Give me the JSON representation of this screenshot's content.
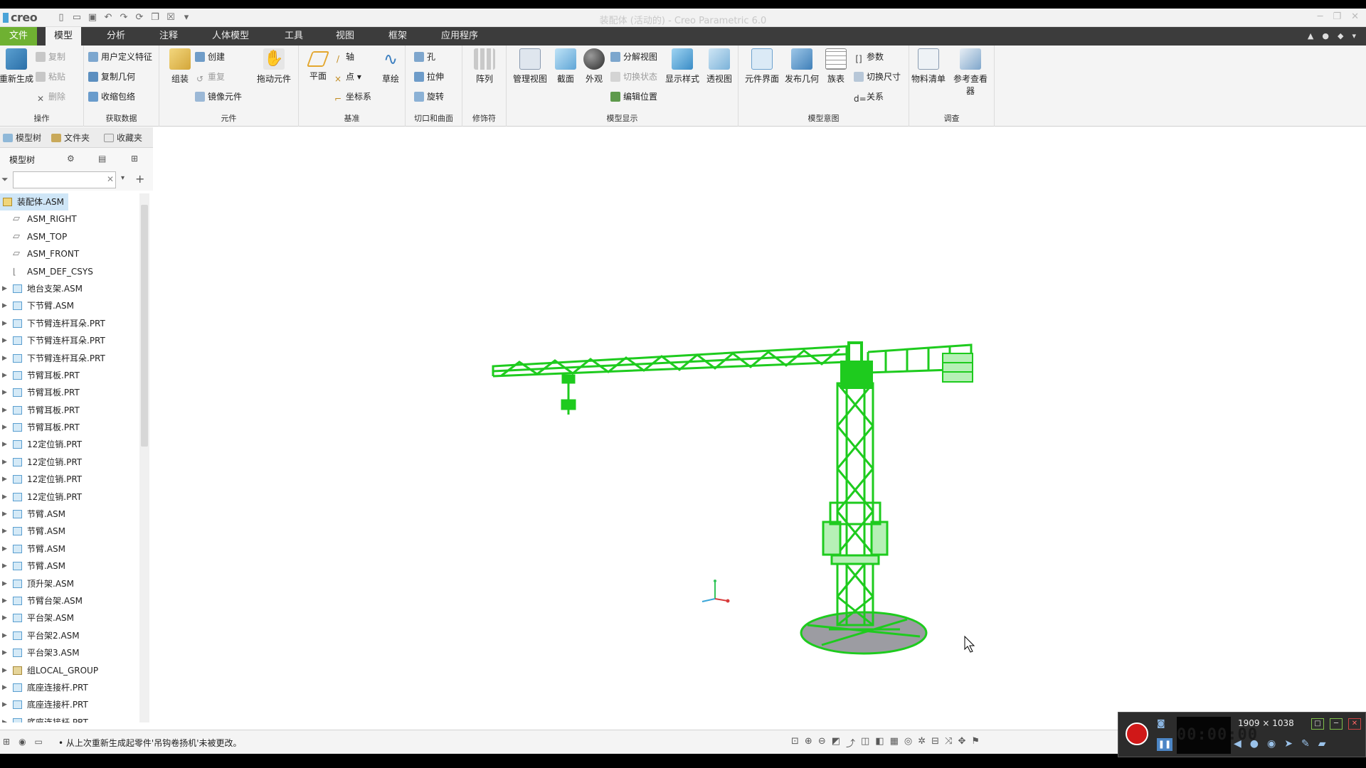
{
  "app": {
    "logo": "creo",
    "window_title": "装配体 (活动的) - Creo Parametric 6.0"
  },
  "menu": {
    "file": "文件",
    "tabs": [
      "模型",
      "分析",
      "注释",
      "人体模型",
      "工具",
      "视图",
      "框架",
      "应用程序"
    ],
    "active_tab": "模型"
  },
  "ribbon": {
    "groups": {
      "operations": {
        "label": "操作",
        "regen": "重新生成",
        "copy": "复制",
        "paste": "粘贴",
        "delete": "删除"
      },
      "get_data": {
        "label": "获取数据",
        "udf": "用户定义特征",
        "copy_geom": "复制几何",
        "shrinkwrap": "收缩包络"
      },
      "component": {
        "label": "元件",
        "assemble": "组装",
        "create": "创建",
        "repeat": "重复",
        "mirror": "镜像元件",
        "drag": "拖动元件"
      },
      "datum": {
        "label": "基准",
        "plane": "平面",
        "axis": "轴",
        "point": "点",
        "csys": "坐标系",
        "sketch": "草绘"
      },
      "cut_surface": {
        "label": "切口和曲面",
        "hole": "孔",
        "extrude": "拉伸",
        "revolve": "旋转"
      },
      "modifiers": {
        "label": "修饰符",
        "pattern": "阵列"
      },
      "model_display": {
        "label": "模型显示",
        "manage_views": "管理视图",
        "section": "截面",
        "appearance": "外观",
        "explode": "分解视图",
        "toggle_state": "切换状态",
        "edit_position": "编辑位置",
        "display_style": "显示样式",
        "perspective": "透视图"
      },
      "model_intent": {
        "label": "模型意图",
        "component_interface": "元件界面",
        "publish_geom": "发布几何",
        "family_table": "族表",
        "params": "参数",
        "switch_dims": "切换尺寸",
        "relations": "关系"
      },
      "investigate": {
        "label": "调查",
        "bom": "物料清单",
        "ref_viewer": "参考查看器"
      }
    }
  },
  "left_panel": {
    "tabs": [
      "模型树",
      "文件夹",
      "收藏夹"
    ],
    "tree_title": "模型树",
    "filter_value": "",
    "items": [
      {
        "label": "装配体.ASM",
        "type": "root"
      },
      {
        "label": "ASM_RIGHT",
        "type": "plane"
      },
      {
        "label": "ASM_TOP",
        "type": "plane"
      },
      {
        "label": "ASM_FRONT",
        "type": "plane"
      },
      {
        "label": "ASM_DEF_CSYS",
        "type": "csys"
      },
      {
        "label": "地台支架.ASM",
        "type": "asm"
      },
      {
        "label": "下节臂.ASM",
        "type": "asm"
      },
      {
        "label": "下节臂连杆耳朵.PRT",
        "type": "prt"
      },
      {
        "label": "下节臂连杆耳朵.PRT",
        "type": "prt"
      },
      {
        "label": "下节臂连杆耳朵.PRT",
        "type": "prt"
      },
      {
        "label": "节臂耳板.PRT",
        "type": "prt"
      },
      {
        "label": "节臂耳板.PRT",
        "type": "prt"
      },
      {
        "label": "节臂耳板.PRT",
        "type": "prt"
      },
      {
        "label": "节臂耳板.PRT",
        "type": "prt"
      },
      {
        "label": "12定位销.PRT",
        "type": "prt"
      },
      {
        "label": "12定位销.PRT",
        "type": "prt"
      },
      {
        "label": "12定位销.PRT",
        "type": "prt"
      },
      {
        "label": "12定位销.PRT",
        "type": "prt"
      },
      {
        "label": "节臂.ASM",
        "type": "asm"
      },
      {
        "label": "节臂.ASM",
        "type": "asm"
      },
      {
        "label": "节臂.ASM",
        "type": "asm"
      },
      {
        "label": "节臂.ASM",
        "type": "asm"
      },
      {
        "label": "顶升架.ASM",
        "type": "asm"
      },
      {
        "label": "节臂台架.ASM",
        "type": "asm"
      },
      {
        "label": "平台架.ASM",
        "type": "asm"
      },
      {
        "label": "平台架2.ASM",
        "type": "asm"
      },
      {
        "label": "平台架3.ASM",
        "type": "asm"
      },
      {
        "label": "组LOCAL_GROUP",
        "type": "group"
      },
      {
        "label": "底座连接杆.PRT",
        "type": "prt"
      },
      {
        "label": "底座连接杆.PRT",
        "type": "prt"
      },
      {
        "label": "底座连接杆.PRT",
        "type": "prt"
      }
    ]
  },
  "status": {
    "message": "• 从上次重新生成起零件'吊钩卷扬机'未被更改。"
  },
  "recorder": {
    "time": "00:00:00",
    "resolution": "1909 × 1038"
  },
  "colors": {
    "model_green": "#1ecb1e",
    "base_gray": "#9c9ca2",
    "file_tab_green": "#6fb132",
    "selection_blue": "#cfe6f7"
  }
}
